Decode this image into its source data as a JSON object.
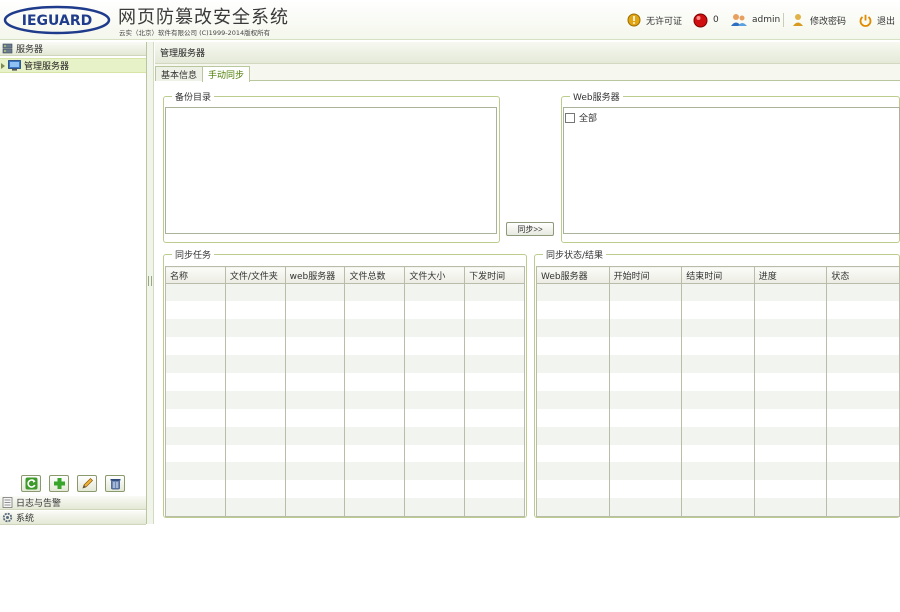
{
  "header": {
    "logo_text": "IEGUARD",
    "app_title": "网页防篡改安全系统",
    "copyright": "云实（北京）软件有限公司 (C)1999-2014版权所有",
    "license_label": "无许可证",
    "alert_count": "0",
    "user_label": "admin",
    "change_password_label": "修改密码",
    "logout_label": "退出"
  },
  "sidebar": {
    "servers_header": "服务器",
    "tree_item": "管理服务器",
    "logs_header": "日志与告警",
    "system_header": "系统"
  },
  "main": {
    "panel_title": "管理服务器",
    "tabs": [
      {
        "label": "基本信息",
        "active": false
      },
      {
        "label": "手动同步",
        "active": true
      }
    ],
    "backup_dir_legend": "备份目录",
    "web_servers_legend": "Web服务器",
    "all_checkbox_label": "全部",
    "sync_button_label": "同步>>",
    "sync_tasks_legend": "同步任务",
    "sync_status_legend": "同步状态/结果",
    "tasks_columns": [
      "名称",
      "文件/文件夹",
      "web服务器",
      "文件总数",
      "文件大小",
      "下发时间"
    ],
    "status_columns": [
      "Web服务器",
      "开始时间",
      "结束时间",
      "进度",
      "状态"
    ]
  },
  "colors": {
    "accent": "#4b7d00",
    "border": "#bccc8f",
    "selected_row": "#e8f2c8"
  }
}
